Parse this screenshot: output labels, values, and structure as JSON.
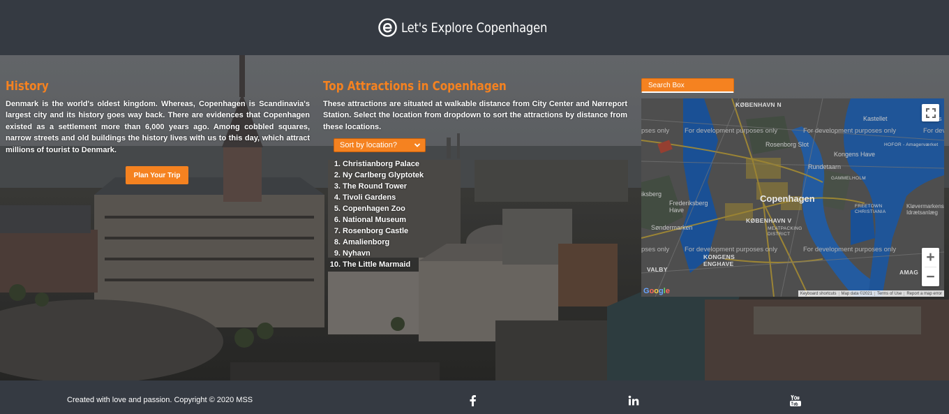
{
  "header": {
    "title": "Let's Explore Copenhagen",
    "logo_icon": "e-logo-icon"
  },
  "history": {
    "title": "History",
    "text": "Denmark is the world's oldest kingdom. Whereas, Copenhagen is Scandinavia's largest city and its history goes way back. There are evidences that Copenhagen existed as a settlement more than 6,000 years ago. Among cobbled squares, narrow streets and old buildings the history lives with us to this day, which attract millions of tourist to Denmark.",
    "button_label": "Plan Your Trip"
  },
  "attractions": {
    "title": "Top Attractions in Copenhagen",
    "text": "These attractions are situated at walkable distance from City Center and Nørreport Station. Select the location from dropdown to sort the attractions by distance from these locations.",
    "sort_label": "Sort by location?",
    "items": [
      {
        "num": "1.",
        "name": "Christianborg Palace"
      },
      {
        "num": "2.",
        "name": "Ny Carlberg Glyptotek"
      },
      {
        "num": "3.",
        "name": "The Round Tower"
      },
      {
        "num": "4.",
        "name": "Tivoli Gardens"
      },
      {
        "num": "5.",
        "name": "Copenhagen Zoo"
      },
      {
        "num": "6.",
        "name": "National Museum"
      },
      {
        "num": "7.",
        "name": "Rosenborg Castle"
      },
      {
        "num": "8.",
        "name": "Amalienborg"
      },
      {
        "num": "9.",
        "name": "Nyhavn"
      },
      {
        "num": "10.",
        "name": "The Little Marmaid"
      }
    ]
  },
  "search": {
    "label": "Search Box"
  },
  "map": {
    "dev_text": "For development purposes only",
    "dev_text_short": "pses only",
    "dev_text_cut": "For development purposes only",
    "dev_text_edge": "For dev",
    "labels": {
      "kobenhavn_n": "KØBENHAVN N",
      "kastellet": "Kastellet",
      "refs": "Refs",
      "rosenborg": "Rosenborg Slot",
      "kongens_have": "Kongens Have",
      "hofor": "HOFOR - Amagerværket",
      "rundetaarn": "Rundetaarn",
      "gammelholm": "GAMMELHOLM",
      "copenhagen": "Copenhagen",
      "frederiksberg": "Frederiksberg Have",
      "sberg": "iksberg",
      "freetown": "FREETOWN CHRISTIANIA",
      "klovermarken": "Kløvermarkens Idrætsanlæg",
      "sondermarken": "Søndermarken",
      "kobenhavn_v": "KØBENHAVN V",
      "meatpacking": "MEATPACKING DISTRICT",
      "kongens_enghave": "KONGENS ENGHAVE",
      "valby": "VALBY",
      "amag": "AMAG"
    },
    "footer": [
      "Keyboard shortcuts",
      "Map data ©2021",
      "Terms of Use",
      "Report a map error"
    ],
    "logo": [
      "G",
      "o",
      "o",
      "g",
      "l",
      "e"
    ],
    "controls": {
      "fullscreen": "fullscreen-icon",
      "zoom_in": "+",
      "zoom_out": "−"
    }
  },
  "footer": {
    "copyright": "Created with love and passion. Copyright © 2020 MSS",
    "social": [
      "facebook-icon",
      "linkedin-icon",
      "youtube-icon"
    ]
  },
  "colors": {
    "accent": "#f58220",
    "header_bg": "#353a42",
    "map_water": "#1f5fb0"
  }
}
